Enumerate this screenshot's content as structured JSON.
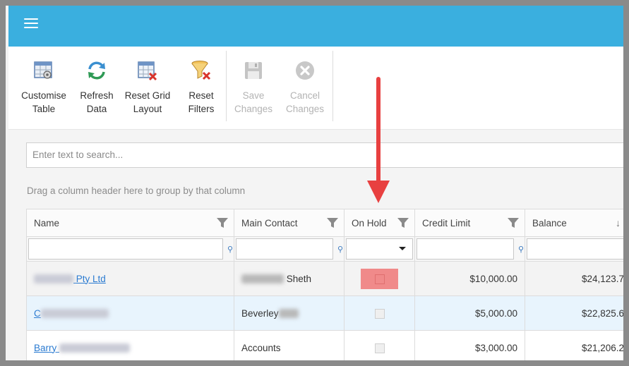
{
  "toolbar": {
    "items": [
      {
        "label": "Customise\nTable",
        "icon": "customise-table-icon"
      },
      {
        "label": "Refresh\nData",
        "icon": "refresh-icon"
      },
      {
        "label": "Reset Grid\nLayout",
        "icon": "reset-grid-icon"
      },
      {
        "label": "Reset\nFilters",
        "icon": "reset-filter-icon"
      },
      {
        "label": "Save\nChanges",
        "icon": "save-icon",
        "disabled": true
      },
      {
        "label": "Cancel\nChanges",
        "icon": "cancel-icon",
        "disabled": true
      }
    ]
  },
  "search": {
    "placeholder": "Enter text to search..."
  },
  "groupby_hint": "Drag a column header here to group by that column",
  "columns": [
    "Name",
    "Main Contact",
    "On Hold",
    "Credit Limit",
    "Balance"
  ],
  "rows": [
    {
      "name": "Pty Ltd",
      "contact": "Sheth",
      "on_hold": false,
      "credit_limit": "$10,000.00",
      "balance": "$24,123.7"
    },
    {
      "name": "C",
      "contact": "Beverley",
      "on_hold": false,
      "credit_limit": "$5,000.00",
      "balance": "$22,825.6"
    },
    {
      "name": "Barry",
      "contact": "Accounts",
      "on_hold": false,
      "credit_limit": "$3,000.00",
      "balance": "$21,206.2"
    }
  ],
  "colors": {
    "topbar": "#3aafdf",
    "link": "#2b7bd1",
    "arrow": "#e84040",
    "highlight": "#f08a8a",
    "selected_row": "#e8f4fd"
  }
}
